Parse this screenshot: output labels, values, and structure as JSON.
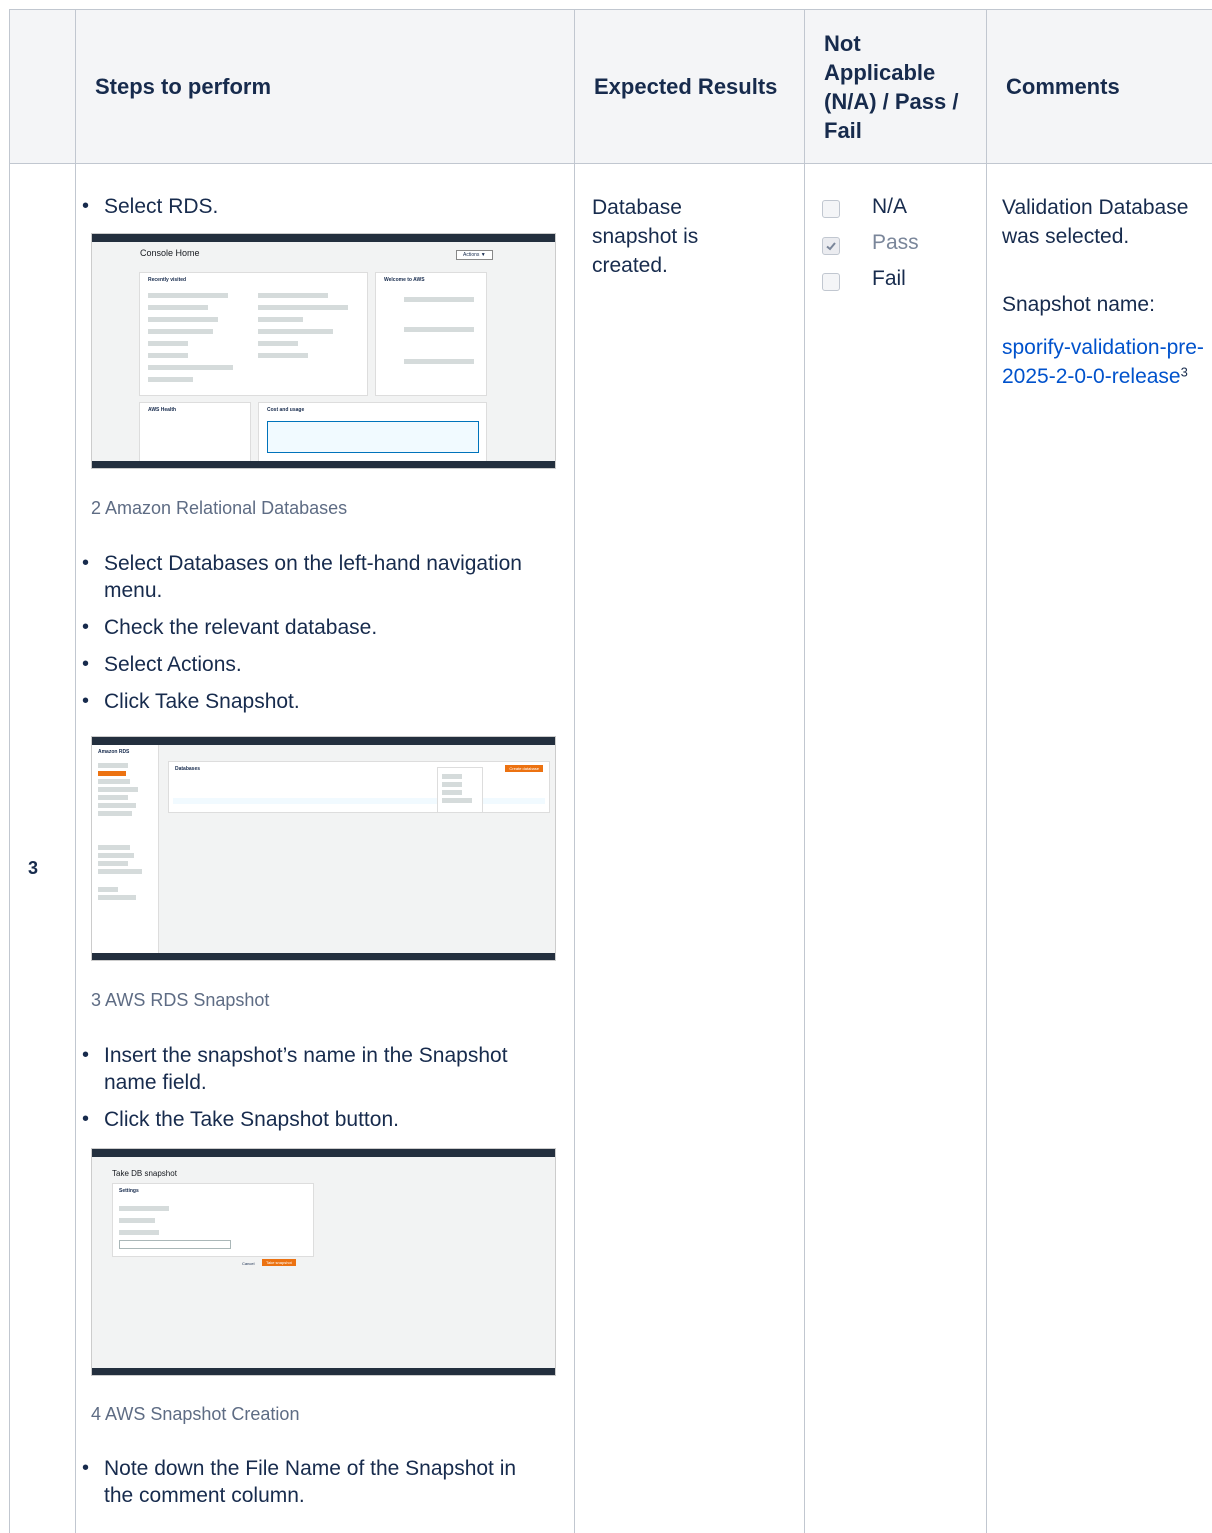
{
  "header": {
    "steps": "Steps to perform",
    "expected": "Expected Results",
    "status": "Not Applicable (N/A) / Pass / Fail",
    "comments": "Comments"
  },
  "row": {
    "number": "3",
    "steps_group1": [
      "Select RDS."
    ],
    "caption1": "2 Amazon Relational Databases",
    "steps_group2": [
      "Select Databases on the left-hand navigation menu.",
      "Check the relevant database.",
      "Select Actions.",
      "Click Take Snapshot."
    ],
    "caption2": "3 AWS RDS Snapshot",
    "steps_group3": [
      "Insert the snapshot’s name in the Snapshot name field.",
      "Click the Take Snapshot button."
    ],
    "caption3": "4 AWS Snapshot Creation",
    "steps_group4": [
      "Note down the File Name of the Snapshot in the comment column."
    ],
    "expected": "Database snapshot is created.",
    "options": [
      {
        "label": "N/A",
        "checked": false
      },
      {
        "label": "Pass",
        "checked": true
      },
      {
        "label": "Fail",
        "checked": false
      }
    ],
    "comment_text": "Validation Database was selected.",
    "snapshot_label": "Snapshot name:",
    "snapshot_link": "sporify-validation-pre-2025-2-0-0-release",
    "footnote": "3"
  },
  "screenshots": {
    "console": {
      "title": "Console Home",
      "actions": "Actions ▼",
      "recent": "Recently visited",
      "welcome": "Welcome to AWS",
      "health": "AWS Health",
      "cost": "Cost and usage"
    },
    "rds": {
      "sidebar_title": "Amazon RDS",
      "panel_title": "Databases",
      "create": "Create database"
    },
    "snapshot": {
      "title": "Take DB snapshot",
      "settings": "Settings",
      "cancel": "Cancel",
      "take": "Take snapshot"
    }
  }
}
